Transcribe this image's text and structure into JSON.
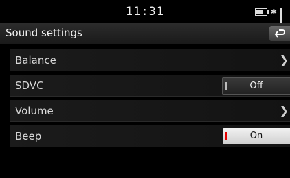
{
  "status": {
    "time": "11:31",
    "icons": [
      "battery-icon",
      "bluetooth-icon",
      "signal-icon"
    ]
  },
  "header": {
    "title": "Sound settings",
    "back_icon": "back-arrow-icon"
  },
  "settings": [
    {
      "label": "Balance",
      "control": "chevron"
    },
    {
      "label": "SDVC",
      "control": "toggle",
      "value": "Off"
    },
    {
      "label": "Volume",
      "control": "chevron"
    },
    {
      "label": "Beep",
      "control": "toggle",
      "value": "On"
    }
  ],
  "colors": {
    "accent": "#e60000",
    "divider": "#8b1d1d",
    "background": "#000000"
  }
}
